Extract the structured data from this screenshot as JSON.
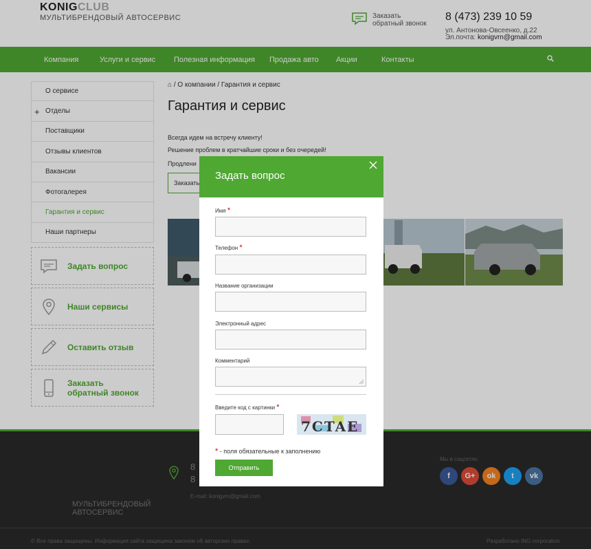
{
  "header": {
    "logo_main": "KONIG",
    "logo_club": "CLUB",
    "logo_sub": "МУЛЬТИБРЕНДОВЫЙ АВТОСЕРВИС",
    "callback_line1": "Заказать",
    "callback_line2": "обратный звонок",
    "phone": "8 (473) 239 10 59",
    "address": "ул. Антонова-Овсеенко, д.22",
    "email_label": "Эл.почта: ",
    "email": "konigvrn@gmail.com"
  },
  "nav": {
    "items": [
      {
        "label": "Компания"
      },
      {
        "label": "Услуги и сервис"
      },
      {
        "label": "Полезная информация"
      },
      {
        "label": "Продажа авто"
      },
      {
        "label": "Акции"
      },
      {
        "label": "Контакты"
      }
    ]
  },
  "sidebar": {
    "items": [
      {
        "label": "О сервисе"
      },
      {
        "label": "Отделы",
        "plus": "+"
      },
      {
        "label": "Поставщики"
      },
      {
        "label": "Отзывы клиентов"
      },
      {
        "label": "Вакансии"
      },
      {
        "label": "Фотогалерея"
      },
      {
        "label": "Гарантия и сервис"
      },
      {
        "label": "Наши партнеры"
      }
    ],
    "boxes": [
      {
        "label": "Задать вопрос",
        "icon": "chat-icon"
      },
      {
        "label": "Наши сервисы",
        "icon": "location-pin-icon"
      },
      {
        "label": "Оставить отзыв",
        "icon": "pencil-icon"
      },
      {
        "label": "Заказать обратный звонок",
        "icon": "mobile-phone-icon"
      }
    ]
  },
  "main": {
    "breadcrumb_home": "⌂",
    "breadcrumb_1": "О компании",
    "breadcrumb_2": "Гарантия и сервис",
    "breadcrumb_sep": "/",
    "title": "Гарантия и сервис",
    "para_1": "Всегда идем на встречу клиенту!",
    "para_2": "Решение проблем в кратчайшие сроки и без очередей!",
    "para_3": "Продлени",
    "order_button": "Заказать"
  },
  "footer": {
    "brand": "МУЛЬТИБРЕНДОВЫЙ АВТОСЕРВИС",
    "phone_1": "8",
    "phone_2": "8",
    "email": "E-mail: konigvrn@gmail.com",
    "social_label": "Мы в соцсетях:",
    "social": [
      {
        "label": "f",
        "color": "#3b5998",
        "icon": "facebook-icon"
      },
      {
        "label": "G+",
        "color": "#dd4b39",
        "icon": "google-plus-icon"
      },
      {
        "label": "ok",
        "color": "#f58220",
        "icon": "odnoklassniki-icon"
      },
      {
        "label": "t",
        "color": "#1da1f2",
        "icon": "twitter-icon"
      },
      {
        "label": "vk",
        "color": "#4c75a3",
        "icon": "vk-icon"
      }
    ],
    "copyright": "© Все права защищены. Информация сайта защищена законом об авторских правах.",
    "developer": "Разработано ING corporation"
  },
  "modal": {
    "title": "Задать вопрос",
    "name_label": "Имя",
    "phone_label": "Телефон",
    "org_label": "Название организации",
    "email_label": "Электронный адрес",
    "comment_label": "Комментарий",
    "captcha_label": "Введите код с картинки",
    "required_mark": "*",
    "required_note": "- поля обязательные к заполнению",
    "submit": "Отправить",
    "captcha_text": "7CTAE"
  },
  "colors": {
    "brand_green": "#4fa832",
    "required_red": "#c00"
  }
}
